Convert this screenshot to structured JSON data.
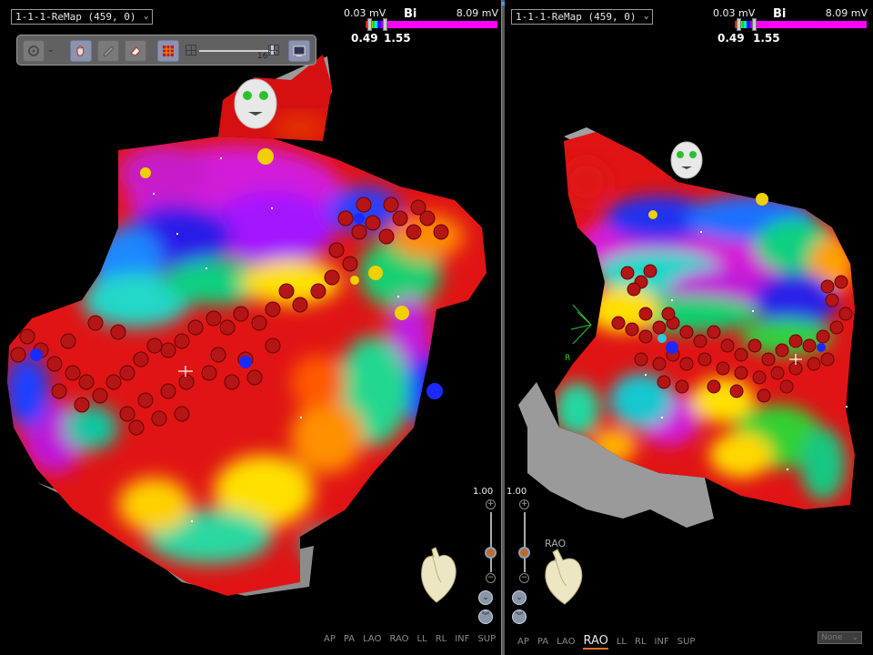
{
  "left_view": {
    "map_name": "1-1-1-ReMap (459, 0)",
    "colorbar": {
      "low": "0.03 mV",
      "mode": "Bi",
      "high": "8.09 mV",
      "lower_threshold": "0.49",
      "upper_threshold": "1.55"
    },
    "toolbar": {
      "slider_value": "16"
    },
    "zoom": {
      "value": "1.00",
      "plus": "+",
      "minus": "−"
    },
    "view_buttons": [
      "AP",
      "PA",
      "LAO",
      "RAO",
      "LL",
      "RL",
      "INF",
      "SUP"
    ],
    "active_view": ""
  },
  "right_view": {
    "map_name": "1-1-1-ReMap (459, 0)",
    "colorbar": {
      "low": "0.03 mV",
      "mode": "Bi",
      "high": "8.09 mV",
      "lower_threshold": "0.49",
      "upper_threshold": "1.55"
    },
    "zoom": {
      "value": "1.00",
      "plus": "+",
      "minus": "−"
    },
    "orientation_label": "RAO",
    "axis_label": "R",
    "view_buttons": [
      "AP",
      "PA",
      "LAO",
      "RAO",
      "LL",
      "RL",
      "INF",
      "SUP"
    ],
    "active_view": "RAO",
    "overlay_select": "None"
  },
  "colors": {
    "lesion": "#b01010",
    "background": "#000000",
    "accent": "#e0702a"
  },
  "icons": [
    "chevron-down-icon",
    "heart-icon",
    "face-marker-icon",
    "gear-icon",
    "hand-icon",
    "eraser-icon",
    "grid-icon",
    "monitor-icon"
  ]
}
